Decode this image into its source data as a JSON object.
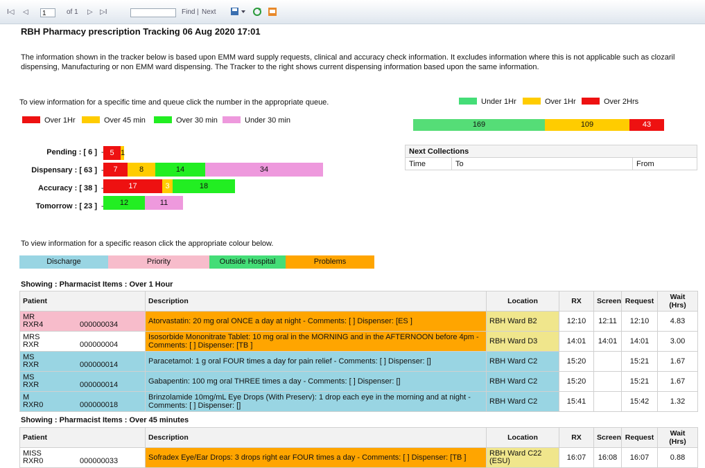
{
  "toolbar": {
    "page_first": "I◁",
    "page_prev": "◁",
    "page_current": "1",
    "page_of": "of 1",
    "page_next": "▷",
    "page_last": "▷I",
    "find_input": "",
    "find_label": "Find",
    "find_sep": "|",
    "next_label": "Next"
  },
  "title": "RBH Pharmacy prescription Tracking 06 Aug 2020  17:01",
  "intro": "The information shown in the tracker below is based upon EMM ward supply requests, clinical and accuracy check information.  It excludes information where this is not applicable such as clozaril dispensing, Manufacturing or non EMM ward dispensing. The Tracker to the right shows current dispensing information based upon the same information.",
  "queue_hint": "To view information for a specific time and queue click the number in the appropriate queue.",
  "queue_legend": [
    {
      "label": "Over 1Hr",
      "color": "#ee1111"
    },
    {
      "label": "Over 45 min",
      "color": "#ffcc00"
    },
    {
      "label": "Over 30 min",
      "color": "#22ee22"
    },
    {
      "label": "Under 30 min",
      "color": "#ee99dd"
    }
  ],
  "queues": [
    {
      "label": "Pending :  [ 6 ]",
      "segments": [
        {
          "value": "5",
          "color": "#ee1111"
        },
        {
          "value": "1",
          "color": "#ffcc00"
        }
      ]
    },
    {
      "label": "Dispensary :  [ 63 ]",
      "segments": [
        {
          "value": "7",
          "color": "#ee1111"
        },
        {
          "value": "8",
          "color": "#ffcc00"
        },
        {
          "value": "14",
          "color": "#22ee22"
        },
        {
          "value": "34",
          "color": "#ee99dd"
        }
      ]
    },
    {
      "label": "Accuracy :  [ 38 ]",
      "segments": [
        {
          "value": "17",
          "color": "#ee1111"
        },
        {
          "value": "3",
          "color": "#ffcc00"
        },
        {
          "value": "18",
          "color": "#22ee22"
        }
      ]
    },
    {
      "label": "Tomorrow :  [ 23 ]",
      "segments": [
        {
          "value": "12",
          "color": "#22ee22"
        },
        {
          "value": "11",
          "color": "#ee99dd"
        }
      ]
    }
  ],
  "queue_dash": "-",
  "tracker_legend": [
    {
      "label": "Under 1Hr",
      "color": "#44dd77"
    },
    {
      "label": "Over 1Hr",
      "color": "#ffcc00"
    },
    {
      "label": "Over 2Hrs",
      "color": "#ee1111"
    }
  ],
  "tracker": [
    {
      "value": "169",
      "color": "#55dd77"
    },
    {
      "value": "109",
      "color": "#ffcc00"
    },
    {
      "value": "43",
      "color": "#ee1111"
    }
  ],
  "next_collections": {
    "title": "Next Collections",
    "col_time": "Time",
    "col_to": "To",
    "col_from": "From"
  },
  "reason_hint": "To view information for a specific reason click the appropriate colour below.",
  "reasons": [
    {
      "label": "Discharge",
      "color": "#99d5e3"
    },
    {
      "label": "Priority",
      "color": "#f7bccb"
    },
    {
      "label": "Outside Hospital",
      "color": "#44dd77"
    },
    {
      "label": "Problems",
      "color": "#ffa500"
    }
  ],
  "columns": {
    "patient": "Patient",
    "description": "Description",
    "location": "Location",
    "rx": "RX",
    "screen": "Screen",
    "request": "Request",
    "wait": "Wait (Hrs)"
  },
  "section1": {
    "title": "Showing : Pharmacist Items : Over 1 Hour",
    "rows": [
      {
        "name": "MR",
        "code": "RXR4",
        "id": "000000034",
        "desc": "Atorvastatin: 20 mg oral ONCE a day at night - Comments: [ ] Dispenser: [ES ]",
        "location": "RBH Ward B2",
        "rx": "12:10",
        "screen": "12:11",
        "request": "12:10",
        "wait": "4.83",
        "pat_color": "#f7bccb",
        "desc_color": "#ffa500",
        "loc_color": "#f0e68c"
      },
      {
        "name": "MRS",
        "code": "RXR",
        "id": "000000004",
        "desc": "Isosorbide Mononitrate Tablet: 10 mg oral in the MORNING and in the AFTERNOON before 4pm - Comments: [ ] Dispenser: [TB ]",
        "location": "RBH Ward D3",
        "rx": "14:01",
        "screen": "14:01",
        "request": "14:01",
        "wait": "3.00",
        "pat_color": "#ffffff",
        "desc_color": "#ffa500",
        "loc_color": "#f0e68c"
      },
      {
        "name": "MS",
        "code": "RXR",
        "id": "000000014",
        "desc": "Paracetamol: 1 g oral FOUR times a day for pain relief - Comments: [ ] Dispenser: []",
        "location": "RBH Ward C2",
        "rx": "15:20",
        "screen": "",
        "request": "15:21",
        "wait": "1.67",
        "pat_color": "#99d5e3",
        "desc_color": "#99d5e3",
        "loc_color": "#99d5e3"
      },
      {
        "name": "MS",
        "code": "RXR",
        "id": "000000014",
        "desc": "Gabapentin: 100 mg oral THREE times a day - Comments: [ ] Dispenser: []",
        "location": "RBH Ward C2",
        "rx": "15:20",
        "screen": "",
        "request": "15:21",
        "wait": "1.67",
        "pat_color": "#99d5e3",
        "desc_color": "#99d5e3",
        "loc_color": "#99d5e3"
      },
      {
        "name": "M",
        "code": "RXR0",
        "id": "000000018",
        "desc": "Brinzolamide 10mg/mL Eye Drops (With Preserv): 1 drop each eye in the morning and at night - Comments: [ ] Dispenser: []",
        "location": "RBH Ward C2",
        "rx": "15:41",
        "screen": "",
        "request": "15:42",
        "wait": "1.32",
        "pat_color": "#99d5e3",
        "desc_color": "#99d5e3",
        "loc_color": "#99d5e3"
      }
    ]
  },
  "section2": {
    "title": "Showing : Pharmacist Items : Over 45 minutes",
    "rows": [
      {
        "name": "MISS",
        "code": "RXR0",
        "id": "000000033",
        "desc": "Sofradex Eye/Ear Drops: 3 drops right ear FOUR times a day - Comments: [ ] Dispenser: [TB ]",
        "location": "RBH Ward C22 (ESU)",
        "rx": "16:07",
        "screen": "16:08",
        "request": "16:07",
        "wait": "0.88",
        "pat_color": "#ffffff",
        "desc_color": "#ffa500",
        "loc_color": "#f0e68c"
      }
    ]
  }
}
